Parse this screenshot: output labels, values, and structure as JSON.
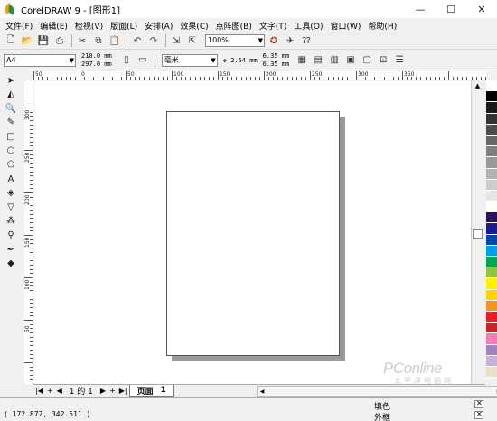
{
  "window": {
    "title": "CorelDRAW 9 - [图形1]",
    "controls": [
      "—",
      "☐",
      "✕"
    ]
  },
  "menubar": [
    "文件(F)",
    "编辑(E)",
    "检视(V)",
    "版面(L)",
    "安排(A)",
    "效果(C)",
    "点阵图(B)",
    "文字(T)",
    "工具(O)",
    "窗口(W)",
    "帮助(H)"
  ],
  "toolbar": {
    "zoom": "100%"
  },
  "property_bar": {
    "page_size": "A4",
    "width": "210.0 mm",
    "height": "297.0 mm",
    "units": "毫米",
    "nudge": "2.54 mm",
    "dup_x": "6.35 mm",
    "dup_y": "6.35 mm"
  },
  "rulers": {
    "horizontal_labels": [
      "50",
      "0",
      "50",
      "100",
      "150",
      "200",
      "250",
      "300",
      "350"
    ],
    "vertical_labels": [
      "300",
      "250",
      "200",
      "150",
      "100",
      "50"
    ]
  },
  "page_nav": {
    "count": "1 的 1",
    "tab_label": "页面",
    "tab_number": "1"
  },
  "status": {
    "coordinates": "( 172.872, 342.511 )",
    "fill_label": "填色",
    "outline_label": "外框"
  },
  "watermark": {
    "main": "PConline",
    "sub": "太平洋电脑网"
  },
  "palette": [
    "#ffffff",
    "#000000",
    "#1a1a1a",
    "#333333",
    "#4d4d4d",
    "#666666",
    "#808080",
    "#999999",
    "#b3b3b3",
    "#cccccc",
    "#e6e6e6",
    "#ffffff",
    "#2e0f5e",
    "#1c1c8f",
    "#0047ab",
    "#00a0e9",
    "#00a651",
    "#8dc63f",
    "#fff200",
    "#ffd400",
    "#f7941d",
    "#ed1c24",
    "#c1272d",
    "#ef7fb2",
    "#a186be",
    "#c7b2d6",
    "#e8e0c8"
  ]
}
